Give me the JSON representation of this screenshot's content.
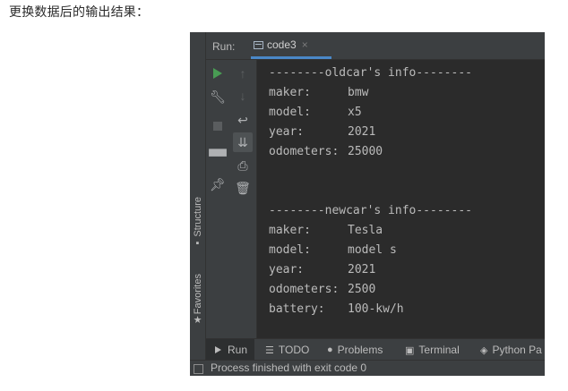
{
  "heading": "更换数据后的输出结果：",
  "run_panel": {
    "label": "Run:",
    "tab_name": "code3",
    "tab_close": "×"
  },
  "side_tabs": {
    "structure": "Structure",
    "favorites": "Favorites"
  },
  "console": {
    "header_old": "--------oldcar's info--------",
    "old": [
      {
        "key": "maker:",
        "value": "bmw"
      },
      {
        "key": "model:",
        "value": "x5"
      },
      {
        "key": "year:",
        "value": "2021"
      },
      {
        "key": "odometers:",
        "value": "25000"
      }
    ],
    "header_new": "--------newcar's info--------",
    "new": [
      {
        "key": "maker:",
        "value": "Tesla"
      },
      {
        "key": "model:",
        "value": "model s"
      },
      {
        "key": "year:",
        "value": "2021"
      },
      {
        "key": "odometers:",
        "value": "2500"
      },
      {
        "key": "battery:",
        "value": "100-kw/h"
      }
    ]
  },
  "bottom_tabs": {
    "run": "Run",
    "todo": "TODO",
    "problems": "Problems",
    "terminal": "Terminal",
    "python": "Python Pa"
  },
  "status": "Process finished with exit code 0",
  "colors": {
    "accent": "#4a88c7",
    "run_green": "#499c54",
    "console_bg": "#2b2b2b",
    "panel_bg": "#3c3f41"
  }
}
